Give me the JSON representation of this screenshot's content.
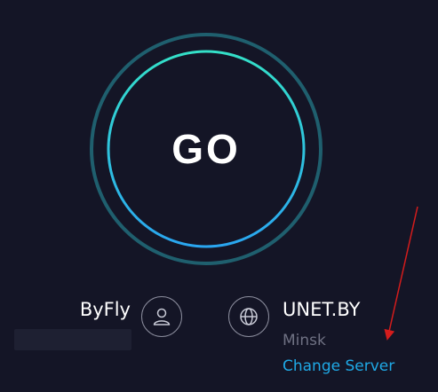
{
  "go_button": {
    "label": "GO"
  },
  "provider": {
    "isp_name": "ByFly",
    "ip_redacted": true
  },
  "server": {
    "name": "UNET.BY",
    "city": "Minsk",
    "change_label": "Change Server"
  },
  "colors": {
    "background": "#141526",
    "ring_outer": "#1f5f6e",
    "ring_gradient_top": "#34e0c8",
    "ring_gradient_bottom": "#2aa6f0",
    "link": "#1fa9e6",
    "annotation_arrow": "#d41c1c"
  },
  "icons": {
    "isp": "user-icon",
    "server": "globe-icon",
    "annotation": "red-arrow"
  }
}
